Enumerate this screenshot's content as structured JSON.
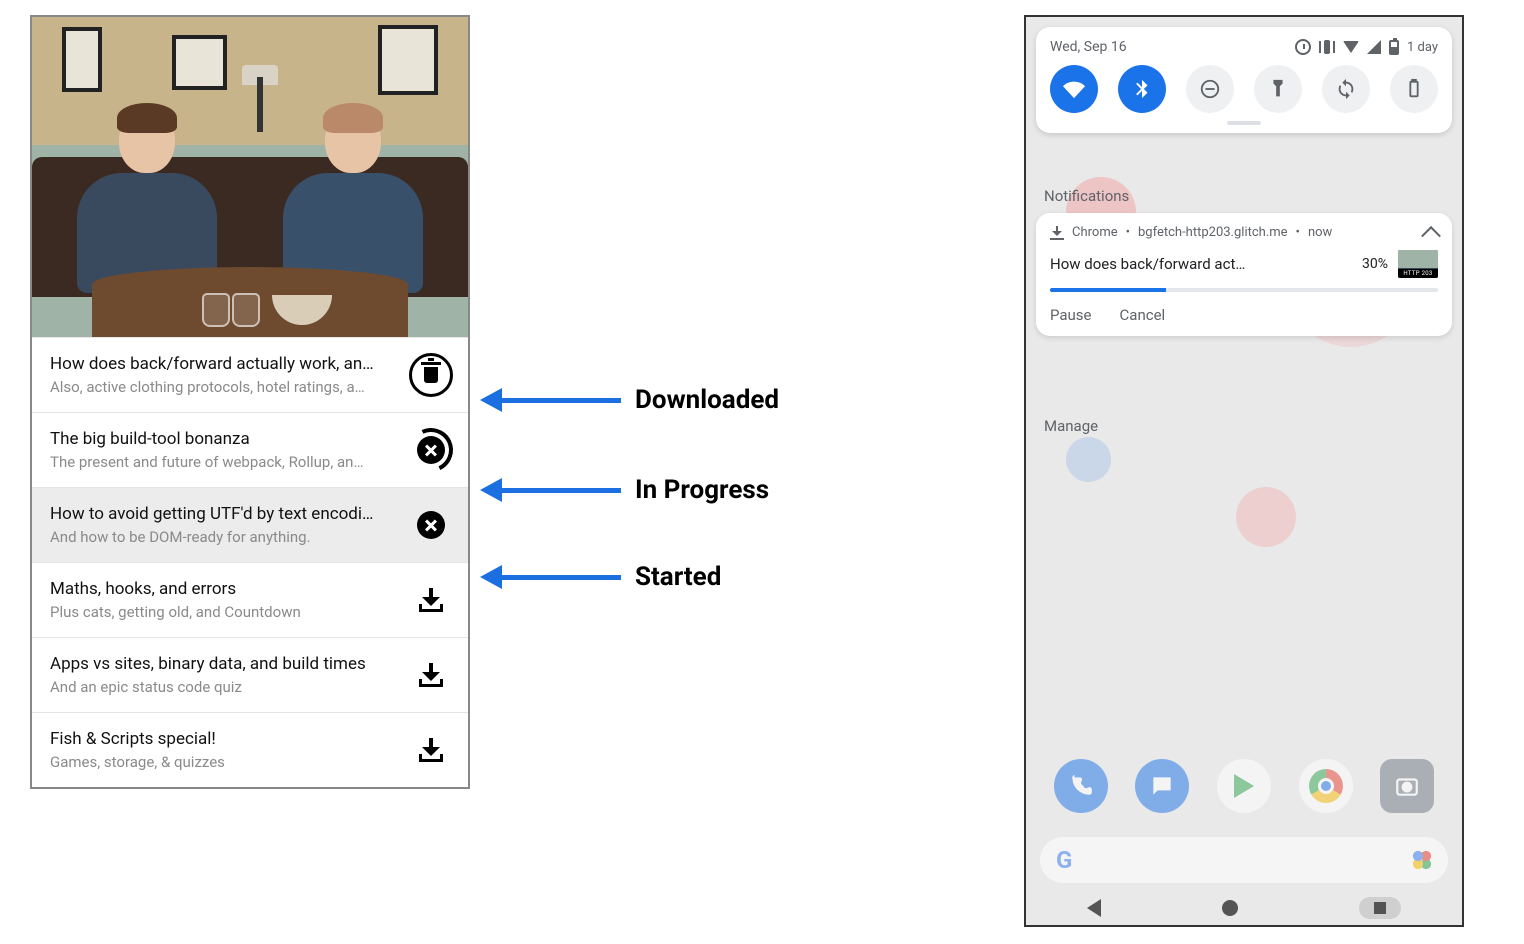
{
  "annotations": {
    "downloaded": "Downloaded",
    "in_progress": "In Progress",
    "started": "Started"
  },
  "episodes": [
    {
      "title": "How does back/forward actually work, an…",
      "sub": "Also, active clothing protocols, hotel ratings, a…",
      "state": "downloaded"
    },
    {
      "title": "The big build-tool bonanza",
      "sub": "The present and future of webpack, Rollup, an…",
      "state": "in_progress"
    },
    {
      "title": "How to avoid getting UTF'd by text encodi…",
      "sub": "And how to be DOM-ready for anything.",
      "state": "started"
    },
    {
      "title": "Maths, hooks, and errors",
      "sub": "Plus cats, getting old, and Countdown",
      "state": "idle"
    },
    {
      "title": "Apps vs sites, binary data, and build times",
      "sub": "And an epic status code quiz",
      "state": "idle"
    },
    {
      "title": "Fish & Scripts special!",
      "sub": "Games, storage, & quizzes",
      "state": "idle"
    }
  ],
  "shade": {
    "date": "Wed, Sep 16",
    "battery_label": "1 day",
    "notifications_header": "Notifications",
    "manage_label": "Manage"
  },
  "notif": {
    "app": "Chrome",
    "origin": "bgfetch-http203.glitch.me",
    "time": "now",
    "title": "How does back/forward act…",
    "percent": "30%",
    "progress_pct": 30,
    "thumb_caption": "HTTP 203",
    "action_pause": "Pause",
    "action_cancel": "Cancel"
  }
}
